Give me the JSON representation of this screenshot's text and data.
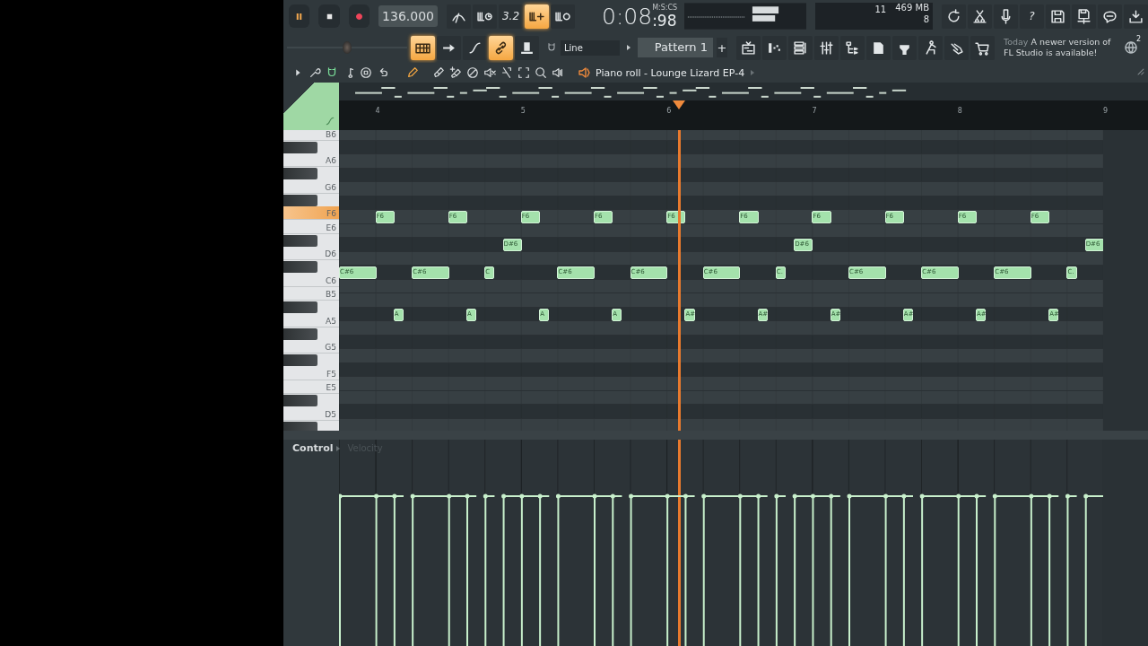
{
  "transport": {
    "buttons": [
      {
        "kind": "pause"
      },
      {
        "kind": "stop"
      },
      {
        "kind": "record"
      }
    ],
    "tempo": "136.000"
  },
  "record_buttons": [
    {
      "kind": "metronome",
      "on": false
    },
    {
      "kind": "comb-clock",
      "on": false
    },
    {
      "kind": "countdown",
      "label": "3.2",
      "on": false
    },
    {
      "kind": "comb-plus",
      "on": true
    },
    {
      "kind": "comb-loop",
      "on": false
    }
  ],
  "time": {
    "label": "M:S:CS",
    "main": "0:08",
    "fraction": ":98"
  },
  "monitor": {
    "cpu": "11",
    "memory": "469 MB",
    "polyphony": "8"
  },
  "system_buttons": [
    {
      "kind": "refresh"
    },
    {
      "kind": "scissors"
    },
    {
      "kind": "microphone"
    },
    {
      "kind": "help",
      "label": "?"
    },
    {
      "kind": "floppy"
    },
    {
      "kind": "floppy-export"
    },
    {
      "kind": "chat"
    },
    {
      "kind": "download"
    }
  ],
  "master_pitch": {
    "level": 0.5
  },
  "edit_buttons": [
    {
      "kind": "keyboard-grid",
      "on": true
    },
    {
      "kind": "arrow-right",
      "on": false
    },
    {
      "kind": "curve",
      "on": false
    },
    {
      "kind": "link",
      "on": true
    },
    {
      "kind": "knob",
      "on": false
    }
  ],
  "snap": "Line",
  "pattern": "Pattern 1",
  "add_pattern": "+",
  "window_buttons": [
    {
      "kind": "playlist"
    },
    {
      "kind": "step-grid"
    },
    {
      "kind": "channels"
    },
    {
      "kind": "mixer"
    },
    {
      "kind": "browser"
    },
    {
      "kind": "file"
    },
    {
      "kind": "plug"
    },
    {
      "kind": "person"
    },
    {
      "kind": "hand"
    },
    {
      "kind": "cart"
    }
  ],
  "hint": {
    "when": "Today",
    "text": "A newer version of FL Studio is available!"
  },
  "notifications": "2",
  "piano_roll": {
    "tools": [
      {
        "kind": "play-triangle",
        "on": false
      },
      {
        "kind": "wrench",
        "on": false
      },
      {
        "kind": "magnet",
        "on": true
      },
      {
        "kind": "note",
        "on": false
      },
      {
        "kind": "circle-dot",
        "on": false
      },
      {
        "kind": "undo",
        "on": false
      },
      {
        "kind": "pencil",
        "on": true
      },
      {
        "kind": "brush",
        "on": false
      },
      {
        "kind": "brush-plus",
        "on": false
      },
      {
        "kind": "no-entry",
        "on": false
      },
      {
        "kind": "mute",
        "on": false
      },
      {
        "kind": "slice",
        "on": false
      },
      {
        "kind": "select",
        "on": false
      },
      {
        "kind": "zoom",
        "on": false
      },
      {
        "kind": "speaker-bars",
        "on": false
      }
    ],
    "title": "Piano roll - Lounge Lizard EP-4",
    "ruler": [
      "4",
      "5",
      "6",
      "7",
      "8",
      "9"
    ],
    "keys": [
      {
        "label": "B6",
        "active": false
      },
      {
        "label": "A6",
        "active": false
      },
      {
        "label": "G6",
        "active": false
      },
      {
        "label": "F6",
        "active": true
      },
      {
        "label": "E6",
        "active": false
      },
      {
        "label": "D6",
        "active": false
      },
      {
        "label": "C6",
        "active": false
      },
      {
        "label": "B5",
        "active": false
      },
      {
        "label": "A5",
        "active": false
      },
      {
        "label": "G5",
        "active": false
      },
      {
        "label": "F5",
        "active": false
      },
      {
        "label": "E5",
        "active": false
      },
      {
        "label": "D5",
        "active": false
      }
    ],
    "notes": [
      {
        "label": "F6"
      },
      {
        "label": "F6"
      },
      {
        "label": "F6"
      },
      {
        "label": "F6"
      },
      {
        "label": "F6"
      },
      {
        "label": "F6"
      },
      {
        "label": "F6"
      },
      {
        "label": "F6"
      },
      {
        "label": "F6"
      },
      {
        "label": "F6"
      },
      {
        "label": "D#6"
      },
      {
        "label": "D#6"
      },
      {
        "label": "D#6"
      },
      {
        "label": "C#6"
      },
      {
        "label": "C#6"
      },
      {
        "label": "C"
      },
      {
        "label": "C#6"
      },
      {
        "label": "C#6"
      },
      {
        "label": "C#6"
      },
      {
        "label": "C."
      },
      {
        "label": "C#6"
      },
      {
        "label": "C#6"
      },
      {
        "label": "C#6"
      },
      {
        "label": "C."
      },
      {
        "label": "A"
      },
      {
        "label": "A"
      },
      {
        "label": "A"
      },
      {
        "label": "A"
      },
      {
        "label": "A#"
      },
      {
        "label": "A#"
      },
      {
        "label": "A#"
      },
      {
        "label": "A#"
      },
      {
        "label": "A#"
      },
      {
        "label": "A#"
      }
    ],
    "control": {
      "label": "Control",
      "parameter": "Velocity"
    }
  }
}
